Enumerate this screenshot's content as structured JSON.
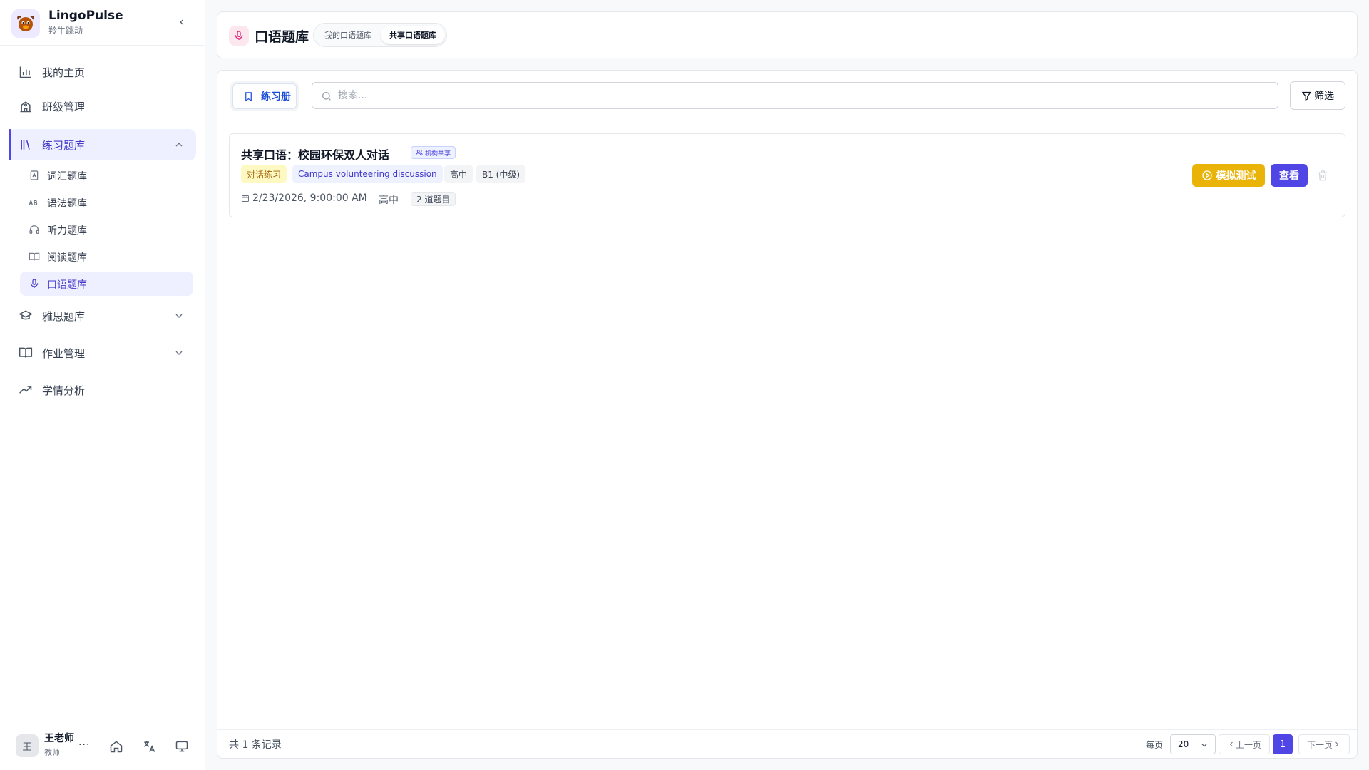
{
  "brand": {
    "name": "LingoPulse",
    "subtitle": "羚牛跳动"
  },
  "sidebar": {
    "items": [
      {
        "label": "我的主页",
        "icon": "bar-chart-icon"
      },
      {
        "label": "班级管理",
        "icon": "school-icon"
      },
      {
        "label": "练习题库",
        "icon": "library-icon",
        "expanded": true,
        "active": true,
        "children": [
          {
            "label": "词汇题库",
            "icon": "vocab-icon"
          },
          {
            "label": "语法题库",
            "icon": "ab-icon"
          },
          {
            "label": "听力题库",
            "icon": "headphones-icon"
          },
          {
            "label": "阅读题库",
            "icon": "book-open-icon"
          },
          {
            "label": "口语题库",
            "icon": "mic-icon",
            "active": true
          }
        ]
      },
      {
        "label": "雅思题库",
        "icon": "graduation-cap-icon"
      },
      {
        "label": "作业管理",
        "icon": "book-icon"
      },
      {
        "label": "学情分析",
        "icon": "trending-up-icon"
      }
    ]
  },
  "user": {
    "avatar": "王",
    "name": "王老师",
    "role": "教师",
    "more": "···"
  },
  "header": {
    "title": "口语题库",
    "tabs": [
      {
        "label": "我的口语题库"
      },
      {
        "label": "共享口语题库",
        "active": true
      }
    ]
  },
  "toolbar": {
    "tab_label": "练习册",
    "search_placeholder": "搜索...",
    "filter_label": "筛选"
  },
  "card": {
    "title": "共享口语：校园环保双人对话",
    "badge": "机构共享",
    "tags": [
      "对话练习",
      "Campus volunteering discussion",
      "高中",
      "B1 (中级)"
    ],
    "date": "2/23/2026, 9:00:00 AM",
    "level": "高中",
    "count": "2 道题目",
    "mock_label": "模拟测试",
    "view_label": "查看"
  },
  "footer": {
    "total": "共 1 条记录",
    "per_page_label": "每页",
    "per_page_value": "20",
    "prev": "上一页",
    "current_page": "1",
    "next": "下一页"
  },
  "colors": {
    "accent": "#4f46e5",
    "warning": "#eab308",
    "mic": "#db2777"
  }
}
